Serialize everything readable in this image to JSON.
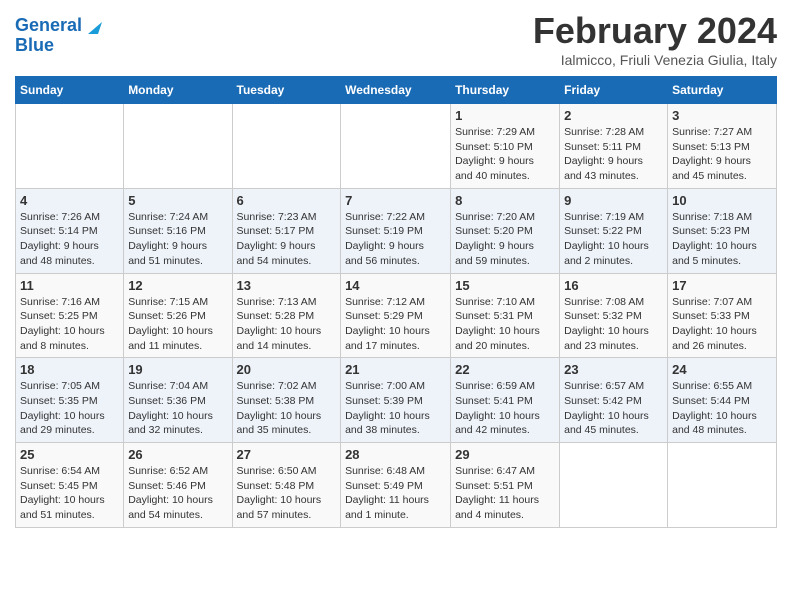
{
  "header": {
    "logo_line1": "General",
    "logo_line2": "Blue",
    "month_title": "February 2024",
    "subtitle": "Ialmicco, Friuli Venezia Giulia, Italy"
  },
  "weekdays": [
    "Sunday",
    "Monday",
    "Tuesday",
    "Wednesday",
    "Thursday",
    "Friday",
    "Saturday"
  ],
  "weeks": [
    [
      {
        "day": "",
        "info": ""
      },
      {
        "day": "",
        "info": ""
      },
      {
        "day": "",
        "info": ""
      },
      {
        "day": "",
        "info": ""
      },
      {
        "day": "1",
        "info": "Sunrise: 7:29 AM\nSunset: 5:10 PM\nDaylight: 9 hours\nand 40 minutes."
      },
      {
        "day": "2",
        "info": "Sunrise: 7:28 AM\nSunset: 5:11 PM\nDaylight: 9 hours\nand 43 minutes."
      },
      {
        "day": "3",
        "info": "Sunrise: 7:27 AM\nSunset: 5:13 PM\nDaylight: 9 hours\nand 45 minutes."
      }
    ],
    [
      {
        "day": "4",
        "info": "Sunrise: 7:26 AM\nSunset: 5:14 PM\nDaylight: 9 hours\nand 48 minutes."
      },
      {
        "day": "5",
        "info": "Sunrise: 7:24 AM\nSunset: 5:16 PM\nDaylight: 9 hours\nand 51 minutes."
      },
      {
        "day": "6",
        "info": "Sunrise: 7:23 AM\nSunset: 5:17 PM\nDaylight: 9 hours\nand 54 minutes."
      },
      {
        "day": "7",
        "info": "Sunrise: 7:22 AM\nSunset: 5:19 PM\nDaylight: 9 hours\nand 56 minutes."
      },
      {
        "day": "8",
        "info": "Sunrise: 7:20 AM\nSunset: 5:20 PM\nDaylight: 9 hours\nand 59 minutes."
      },
      {
        "day": "9",
        "info": "Sunrise: 7:19 AM\nSunset: 5:22 PM\nDaylight: 10 hours\nand 2 minutes."
      },
      {
        "day": "10",
        "info": "Sunrise: 7:18 AM\nSunset: 5:23 PM\nDaylight: 10 hours\nand 5 minutes."
      }
    ],
    [
      {
        "day": "11",
        "info": "Sunrise: 7:16 AM\nSunset: 5:25 PM\nDaylight: 10 hours\nand 8 minutes."
      },
      {
        "day": "12",
        "info": "Sunrise: 7:15 AM\nSunset: 5:26 PM\nDaylight: 10 hours\nand 11 minutes."
      },
      {
        "day": "13",
        "info": "Sunrise: 7:13 AM\nSunset: 5:28 PM\nDaylight: 10 hours\nand 14 minutes."
      },
      {
        "day": "14",
        "info": "Sunrise: 7:12 AM\nSunset: 5:29 PM\nDaylight: 10 hours\nand 17 minutes."
      },
      {
        "day": "15",
        "info": "Sunrise: 7:10 AM\nSunset: 5:31 PM\nDaylight: 10 hours\nand 20 minutes."
      },
      {
        "day": "16",
        "info": "Sunrise: 7:08 AM\nSunset: 5:32 PM\nDaylight: 10 hours\nand 23 minutes."
      },
      {
        "day": "17",
        "info": "Sunrise: 7:07 AM\nSunset: 5:33 PM\nDaylight: 10 hours\nand 26 minutes."
      }
    ],
    [
      {
        "day": "18",
        "info": "Sunrise: 7:05 AM\nSunset: 5:35 PM\nDaylight: 10 hours\nand 29 minutes."
      },
      {
        "day": "19",
        "info": "Sunrise: 7:04 AM\nSunset: 5:36 PM\nDaylight: 10 hours\nand 32 minutes."
      },
      {
        "day": "20",
        "info": "Sunrise: 7:02 AM\nSunset: 5:38 PM\nDaylight: 10 hours\nand 35 minutes."
      },
      {
        "day": "21",
        "info": "Sunrise: 7:00 AM\nSunset: 5:39 PM\nDaylight: 10 hours\nand 38 minutes."
      },
      {
        "day": "22",
        "info": "Sunrise: 6:59 AM\nSunset: 5:41 PM\nDaylight: 10 hours\nand 42 minutes."
      },
      {
        "day": "23",
        "info": "Sunrise: 6:57 AM\nSunset: 5:42 PM\nDaylight: 10 hours\nand 45 minutes."
      },
      {
        "day": "24",
        "info": "Sunrise: 6:55 AM\nSunset: 5:44 PM\nDaylight: 10 hours\nand 48 minutes."
      }
    ],
    [
      {
        "day": "25",
        "info": "Sunrise: 6:54 AM\nSunset: 5:45 PM\nDaylight: 10 hours\nand 51 minutes."
      },
      {
        "day": "26",
        "info": "Sunrise: 6:52 AM\nSunset: 5:46 PM\nDaylight: 10 hours\nand 54 minutes."
      },
      {
        "day": "27",
        "info": "Sunrise: 6:50 AM\nSunset: 5:48 PM\nDaylight: 10 hours\nand 57 minutes."
      },
      {
        "day": "28",
        "info": "Sunrise: 6:48 AM\nSunset: 5:49 PM\nDaylight: 11 hours\nand 1 minute."
      },
      {
        "day": "29",
        "info": "Sunrise: 6:47 AM\nSunset: 5:51 PM\nDaylight: 11 hours\nand 4 minutes."
      },
      {
        "day": "",
        "info": ""
      },
      {
        "day": "",
        "info": ""
      }
    ]
  ]
}
